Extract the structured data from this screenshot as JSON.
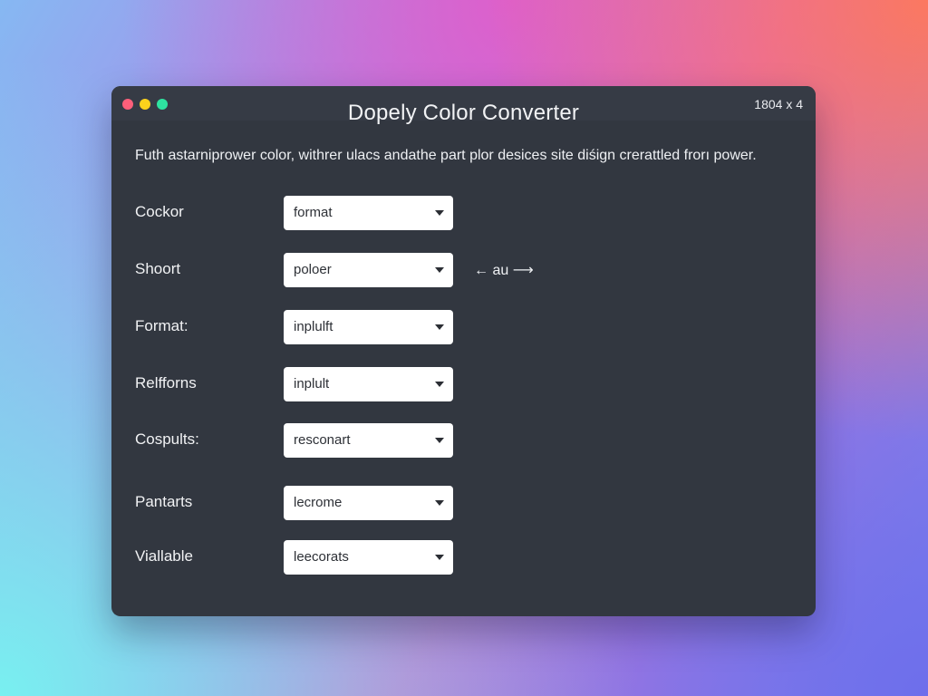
{
  "window": {
    "title": "Dopely Color Converter",
    "dimensions_label": "1804 x 4",
    "description": "Futh astarniprower color, withrer ulacs andathe part plor desices site diśign crerattled frorı power."
  },
  "controls": {
    "window_buttons": [
      "close",
      "minimize",
      "maximize"
    ],
    "swap_hint": "← au ⟶"
  },
  "rows": [
    {
      "label": "Cockor",
      "value": "format"
    },
    {
      "label": "Shoort",
      "value": "poloer"
    },
    {
      "label": "Format:",
      "value": "inplulft"
    },
    {
      "label": "Relfforns",
      "value": "inplult"
    },
    {
      "label": "Cospults:",
      "value": "resconart"
    },
    {
      "label": "Pantarts",
      "value": "lecrome"
    },
    {
      "label": "Viallable",
      "value": "leecorats"
    }
  ],
  "icons": {
    "dropdown": "chevron-down-icon",
    "swap": "arrow-swap-icon"
  },
  "colors": {
    "window_bg": "#323740",
    "close": "#ff5f7a",
    "minimize": "#fcd21c",
    "maximize": "#2ee3a0"
  }
}
